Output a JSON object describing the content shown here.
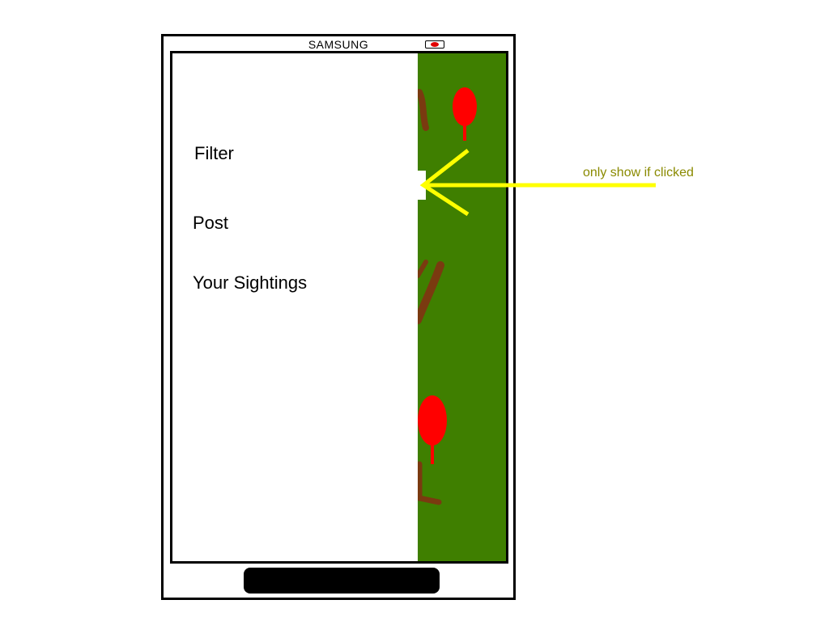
{
  "device": {
    "brand": "SAMSUNG"
  },
  "drawer": {
    "items": [
      {
        "label": "Filter"
      },
      {
        "label": "Post"
      },
      {
        "label": "Your Sightings"
      }
    ]
  },
  "map": {
    "background_color": "#3f7f00",
    "marker_color": "#ff0000",
    "trail_color": "#7a3a10"
  },
  "annotation": {
    "text": "only show if clicked",
    "arrow_color": "#ffff00",
    "text_color": "#8a8a00"
  }
}
